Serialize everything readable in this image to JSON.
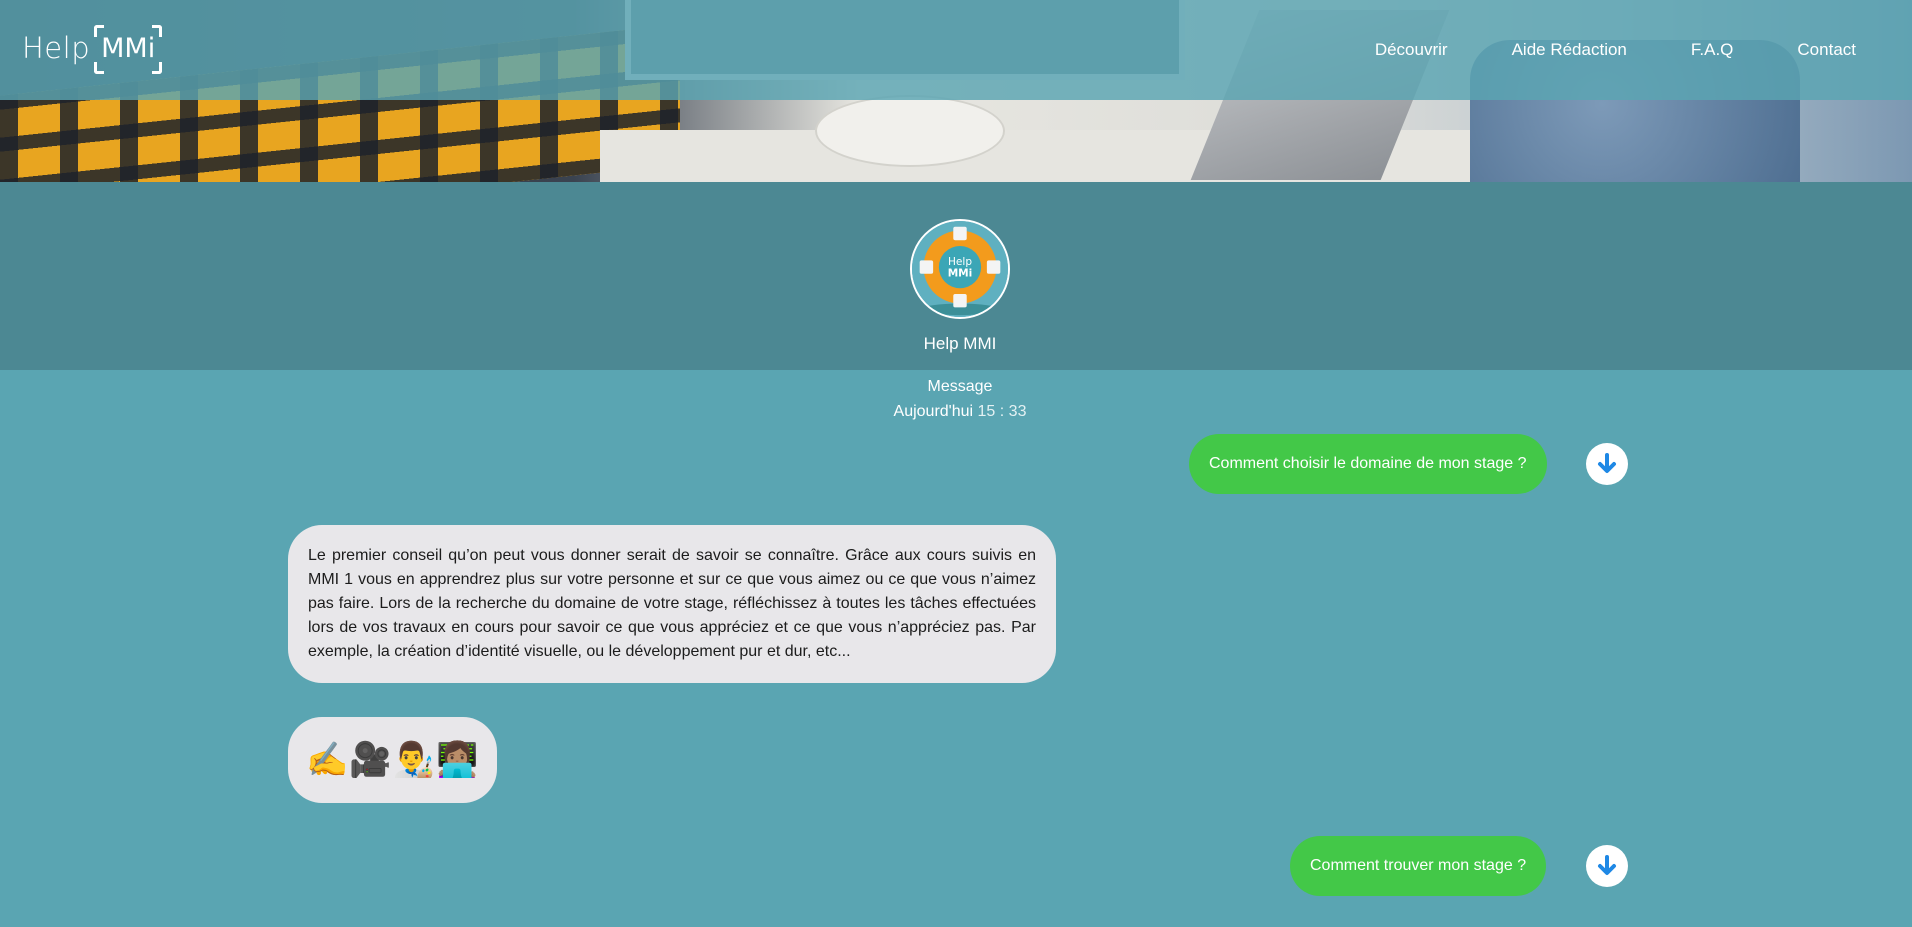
{
  "header": {
    "logo": {
      "help": "Help",
      "mmi": "MMi"
    },
    "nav": [
      "Découvrir",
      "Aide Rédaction",
      "F.A.Q",
      "Contact"
    ]
  },
  "profile": {
    "name": "Help MMI",
    "avatar_text": {
      "line1": "Help",
      "line2": "MMi"
    }
  },
  "chat": {
    "label": "Message",
    "day": "Aujourd'hui",
    "time": "15 : 33",
    "messages": [
      {
        "from": "user",
        "text": "Comment choisir le domaine de mon stage ?"
      },
      {
        "from": "bot",
        "text": "Le premier conseil qu’on peut vous donner serait de savoir se connaître. Grâce aux cours suivis en MMI 1 vous en apprendrez plus sur votre personne et sur ce que vous aimez ou ce que vous n’aimez pas faire. Lors de la recherche du domaine de votre stage, réfléchissez à toutes les tâches effectuées lors de vos travaux en cours pour savoir ce que vous appréciez et ce que vous n’appréciez pas. Par exemple, la création d’identité visuelle, ou le développement pur et dur, etc..."
      },
      {
        "from": "bot",
        "text": "✍️🎥👨‍🎨👩🏽‍💻"
      },
      {
        "from": "user",
        "text": "Comment trouver mon stage ?"
      }
    ]
  },
  "colors": {
    "page_bg": "#5aa5b2",
    "profile_bg": "#4c8893",
    "user_bubble": "#43c848",
    "bot_bubble": "#e8e7ea",
    "download_arrow": "#1e88e5"
  },
  "icons": {
    "download": "arrow-down-circle-icon"
  }
}
